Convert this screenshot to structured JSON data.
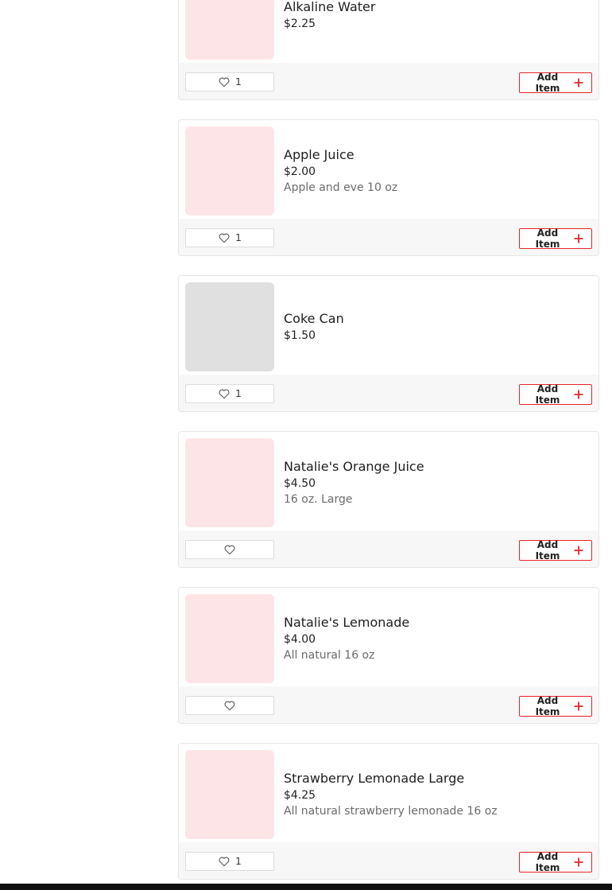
{
  "colors": {
    "accent": "#e8232a",
    "placeholder_pink": "#fde5e7",
    "placeholder_gray": "#e0e0e0",
    "footer_bg": "#f7f7f7"
  },
  "icons": {
    "like": "heart-outline-icon",
    "add": "plus-icon"
  },
  "add_label": "Add Item",
  "items": [
    {
      "name": "Alkaline Water",
      "price": "$2.25",
      "desc": "",
      "likes": "1",
      "thumb": "pink"
    },
    {
      "name": "Apple Juice",
      "price": "$2.00",
      "desc": "Apple and eve 10 oz",
      "likes": "1",
      "thumb": "pink"
    },
    {
      "name": "Coke Can",
      "price": "$1.50",
      "desc": "",
      "likes": "1",
      "thumb": "gray"
    },
    {
      "name": "Natalie's Orange Juice",
      "price": "$4.50",
      "desc": "16 oz. Large",
      "likes": "",
      "thumb": "pink"
    },
    {
      "name": "Natalie's Lemonade",
      "price": "$4.00",
      "desc": "All natural 16 oz",
      "likes": "",
      "thumb": "pink"
    },
    {
      "name": "Strawberry Lemonade Large",
      "price": "$4.25",
      "desc": "All natural strawberry lemonade 16 oz",
      "likes": "1",
      "thumb": "pink"
    }
  ]
}
